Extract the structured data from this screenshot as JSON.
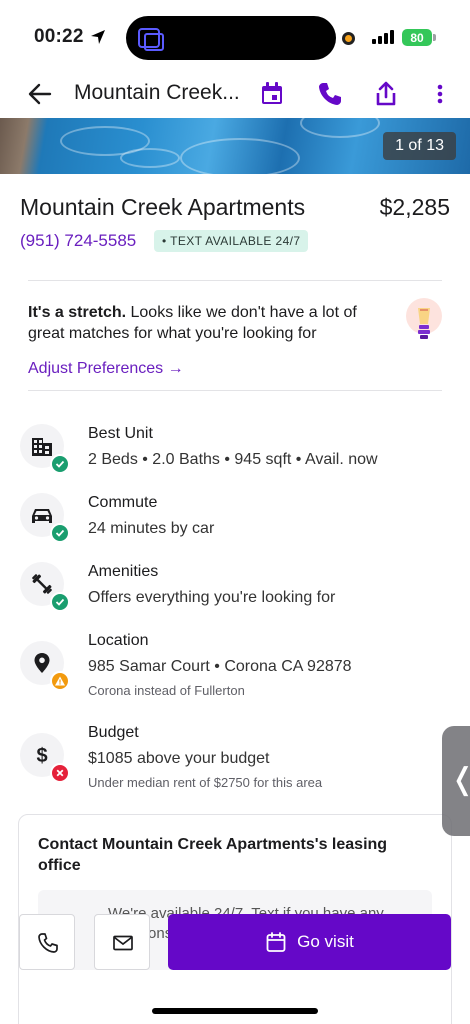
{
  "status_bar": {
    "time": "00:22",
    "battery": "80"
  },
  "header": {
    "title": "Mountain Creek..."
  },
  "photo": {
    "counter": "1 of 13"
  },
  "listing": {
    "name": "Mountain Creek Apartments",
    "price": "$2,285",
    "phone": "(951) 724-5585",
    "text_badge": "• TEXT AVAILABLE 24/7"
  },
  "stretch": {
    "bold": "It's a stretch.",
    "message": " Looks like we don't have a lot of great matches for what you're looking for",
    "adjust_label": "Adjust Preferences →"
  },
  "criteria": [
    {
      "title": "Best Unit",
      "detail": "2 Beds • 2.0 Baths • 945 sqft • Avail. now",
      "sub": "",
      "status": "check",
      "icon": "building-icon"
    },
    {
      "title": "Commute",
      "detail": "24 minutes by car",
      "sub": "",
      "status": "check",
      "icon": "car-icon"
    },
    {
      "title": "Amenities",
      "detail": "Offers everything you're looking for",
      "sub": "",
      "status": "check",
      "icon": "dumbbell-icon"
    },
    {
      "title": "Location",
      "detail": "985 Samar Court • Corona CA 92878",
      "sub": "Corona instead of Fullerton",
      "status": "warning",
      "icon": "location-pin-icon"
    },
    {
      "title": "Budget",
      "detail": "$1085 above your budget",
      "sub": "Under median rent of $2750 for this area",
      "status": "error",
      "icon": "dollar-icon"
    }
  ],
  "contact": {
    "title": "Contact Mountain Creek Apartments's leasing office",
    "inner_text": "We're available 24/7. Text if you have any questions"
  },
  "bottom_bar": {
    "go_visit_label": "Go visit"
  },
  "colors": {
    "accent": "#6508c8",
    "link": "#6a1fbf",
    "check": "#1a9e6f",
    "warning": "#f29a0e",
    "error": "#e5213a"
  }
}
